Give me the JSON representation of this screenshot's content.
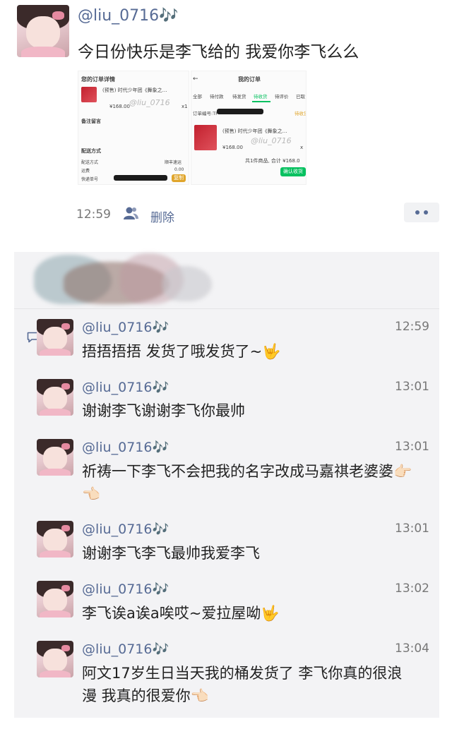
{
  "post": {
    "username": "@liu_0716🎶",
    "text": "今日份快乐是李飞给的 我爱你李飞么么",
    "time": "12:59",
    "visibility_icon": "people-icon",
    "delete_label": "删除",
    "more_icon": "more-dots-icon"
  },
  "order_detail": {
    "title": "您的订单详情",
    "product": "(预售) 时代少年团《舞象之…",
    "price": "¥168.00",
    "qty": "x1",
    "note_label": "备注留言",
    "delivery_title": "配送方式",
    "rows": [
      {
        "label": "配送方式",
        "value": "顺丰速运"
      },
      {
        "label": "运费",
        "value": "0.00"
      },
      {
        "label": "快递单号",
        "value": ""
      }
    ],
    "copy_button": "复制",
    "watermark": "@liu_0716"
  },
  "my_orders": {
    "back": "←",
    "title": "我的订单",
    "tabs": [
      "全部",
      "待付款",
      "待发货",
      "待收货",
      "待评价",
      "已取"
    ],
    "order_no_label": "订单编号:TF",
    "status": "待收货",
    "product": "(预售) 时代少年团《舞象之…",
    "price": "¥168.00",
    "qty": "x",
    "summary": "共1件商品, 合计 ¥168.0",
    "confirm_button": "确认收货",
    "watermark": "@liu_0716"
  },
  "comments": [
    {
      "name": "@liu_0716🎶",
      "time": "12:59",
      "text": "捂捂捂捂 发货了哦发货了~🤟"
    },
    {
      "name": "@liu_0716🎶",
      "time": "13:01",
      "text": "谢谢李飞谢谢李飞你最帅"
    },
    {
      "name": "@liu_0716🎶",
      "time": "13:01",
      "text": "祈祷一下李飞不会把我的名字改成马嘉祺老婆婆👉🏻👈🏻"
    },
    {
      "name": "@liu_0716🎶",
      "time": "13:01",
      "text": "谢谢李飞李飞最帅我爱李飞"
    },
    {
      "name": "@liu_0716🎶",
      "time": "13:02",
      "text": "李飞诶a诶a唉哎~爱拉屋呦🤟"
    },
    {
      "name": "@liu_0716🎶",
      "time": "13:04",
      "text": "阿文17岁生日当天我的桶发货了 李飞你真的很浪漫 我真的很爱你👈🏻"
    }
  ],
  "colors": {
    "link_blue": "#576b95",
    "panel_bg": "#f3f3f5",
    "wechat_green": "#07c160"
  }
}
